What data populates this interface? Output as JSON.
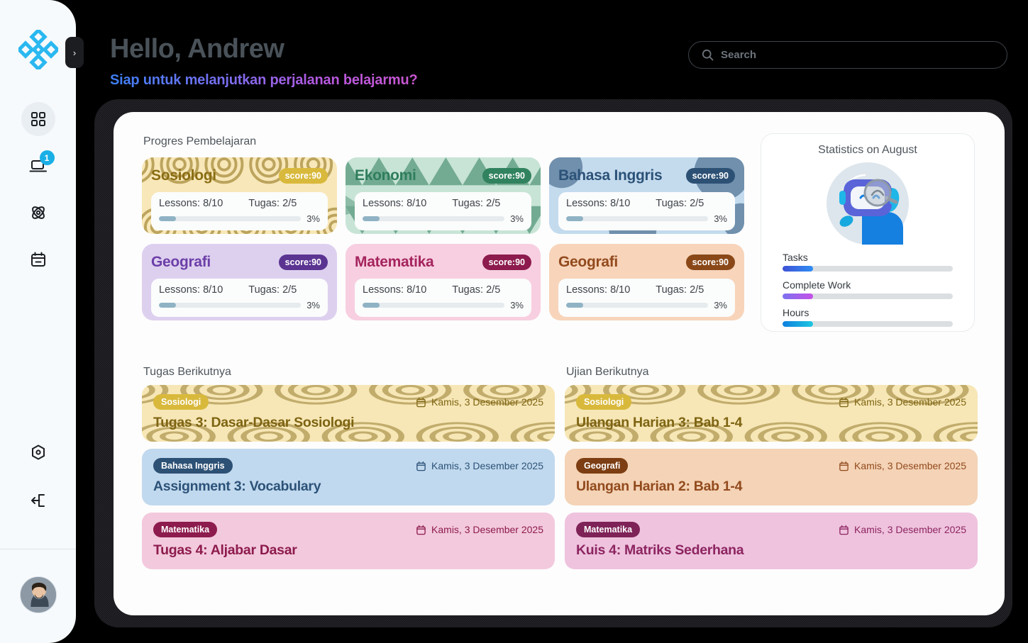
{
  "brand": {
    "logo_name": "diamond-cluster-logo",
    "accent": "#2ab8f0"
  },
  "sidebar": {
    "toggle_label": "›",
    "items": [
      {
        "icon": "grid-dashboard-icon",
        "name": "dashboard",
        "active": true,
        "badge": ""
      },
      {
        "icon": "laptop-icon",
        "name": "courses",
        "active": false,
        "badge": "1"
      },
      {
        "icon": "atom-icon",
        "name": "science",
        "active": false,
        "badge": ""
      },
      {
        "icon": "calendar-icon",
        "name": "calendar",
        "active": false,
        "badge": ""
      }
    ],
    "bottom_items": [
      {
        "icon": "gear-icon",
        "name": "settings"
      },
      {
        "icon": "logout-icon",
        "name": "logout"
      }
    ],
    "avatar_name": "user-avatar"
  },
  "header": {
    "greeting": "Hello, Andrew",
    "subtitle": "Siap untuk melanjutkan perjalanan belajarmu?"
  },
  "search": {
    "placeholder": "Search",
    "value": "",
    "icon": "search-icon"
  },
  "main": {
    "progress_title": "Progres Pembelajaran",
    "tasks_title": "Tugas Berikutnya",
    "exams_title": "Ujian Berikutnya"
  },
  "subjects": [
    {
      "name": "Sosiologi",
      "score": "score:90",
      "lessons": "Lessons: 8/10",
      "tugas": "Tugas: 2/5",
      "percent": "3%",
      "percent_value": 3,
      "bg": "#f8e7b8",
      "text": "#8a6d13",
      "badge_bg": "#d9b93c",
      "pattern": "arcs"
    },
    {
      "name": "Ekonomi",
      "score": "score:90",
      "lessons": "Lessons: 8/10",
      "tugas": "Tugas: 2/5",
      "percent": "3%",
      "percent_value": 3,
      "bg": "#c8e4d6",
      "text": "#2f7d5c",
      "badge_bg": "#31825f",
      "pattern": "triangles"
    },
    {
      "name": "Bahasa Inggris",
      "score": "score:90",
      "lessons": "Lessons: 8/10",
      "tugas": "Tugas: 2/5",
      "percent": "3%",
      "percent_value": 3,
      "bg": "#c4dbee",
      "text": "#2c5278",
      "badge_bg": "#2d5175",
      "pattern": "blobs"
    },
    {
      "name": "Geografi",
      "score": "score:90",
      "lessons": "Lessons: 8/10",
      "tugas": "Tugas: 2/5",
      "percent": "3%",
      "percent_value": 3,
      "bg": "#ddd0ef",
      "text": "#6c3fa8",
      "badge_bg": "#5b3492",
      "pattern": "none"
    },
    {
      "name": "Matematika",
      "score": "score:90",
      "lessons": "Lessons: 8/10",
      "tugas": "Tugas: 2/5",
      "percent": "3%",
      "percent_value": 3,
      "bg": "#f7cfe0",
      "text": "#a5245e",
      "badge_bg": "#8d1b4d",
      "pattern": "none"
    },
    {
      "name": "Geografi",
      "score": "score:90",
      "lessons": "Lessons: 8/10",
      "tugas": "Tugas: 2/5",
      "percent": "3%",
      "percent_value": 3,
      "bg": "#f7d4ba",
      "text": "#924a1d",
      "badge_bg": "#8a4818",
      "pattern": "none"
    }
  ],
  "statistics": {
    "title": "Statistics on August",
    "illustration": "robot-magnifier-illustration",
    "bars": [
      {
        "label": "Tasks",
        "percent": 18,
        "gradient_from": "#3f51d6",
        "gradient_to": "#2f8ef4"
      },
      {
        "label": "Complete Work",
        "percent": 18,
        "gradient_from": "#7b72ef",
        "gradient_to": "#c650e8"
      },
      {
        "label": "Hours",
        "percent": 18,
        "gradient_from": "#0d7fe0",
        "gradient_to": "#1fc8e0"
      }
    ]
  },
  "tasks": [
    {
      "badge": "Sosiologi",
      "title": "Tugas 3: Dasar-Dasar Sosiologi",
      "date": "Kamis, 3 Desember 2025",
      "bg": "#f7e7b6",
      "text": "#7e6412",
      "badge_bg": "#d9b93c",
      "pattern": "arcs"
    },
    {
      "badge": "Bahasa Inggris",
      "title": "Assignment 3: Vocabulary",
      "date": "Kamis, 3 Desember 2025",
      "bg": "#c1d9ee",
      "text": "#2c5278",
      "badge_bg": "#2d5175",
      "pattern": "none"
    },
    {
      "badge": "Matematika",
      "title": "Tugas 4: Aljabar Dasar",
      "date": "Kamis, 3 Desember 2025",
      "bg": "#f3c9dd",
      "text": "#8d1b4d",
      "badge_bg": "#8d1b4d",
      "pattern": "none"
    }
  ],
  "exams": [
    {
      "badge": "Sosiologi",
      "title": "Ulangan Harian 3: Bab 1-4",
      "date": "Kamis, 3 Desember 2025",
      "bg": "#f7e7b6",
      "text": "#7e6412",
      "badge_bg": "#d9b93c",
      "pattern": "arcs"
    },
    {
      "badge": "Geografi",
      "title": "Ulangan Harian 2: Bab 1-4",
      "date": "Kamis, 3 Desember 2025",
      "bg": "#f4d3b6",
      "text": "#924a1d",
      "badge_bg": "#7d3e13",
      "pattern": "none"
    },
    {
      "badge": "Matematika",
      "title": "Kuis 4: Matriks Sederhana",
      "date": "Kamis, 3 Desember 2025",
      "bg": "#efc3de",
      "text": "#8d2561",
      "badge_bg": "#7e2257",
      "pattern": "none"
    }
  ]
}
